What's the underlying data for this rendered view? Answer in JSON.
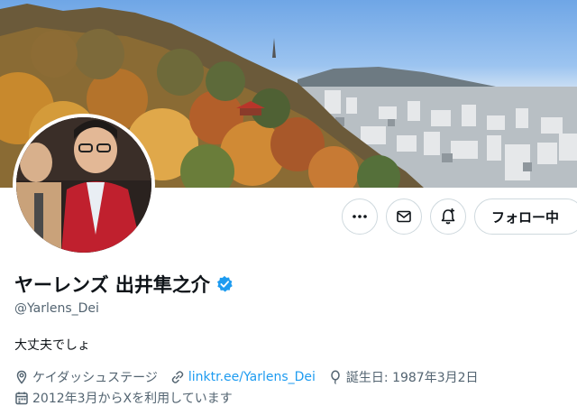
{
  "profile": {
    "display_name": "ヤーレンズ 出井隼之介",
    "verified": true,
    "handle": "@Yarlens_Dei",
    "bio": "大丈夫でしょ",
    "location": "ケイダッシュステージ",
    "website": "linktr.ee/Yarlens_Dei",
    "birthday": "誕生日: 1987年3月2日",
    "joined": "2012年3月からXを利用しています"
  },
  "actions": {
    "follow_label": "フォロー中"
  },
  "icons": {
    "more": "more-icon",
    "message": "mail-icon",
    "notify": "bell-plus-icon",
    "location": "location-pin-icon",
    "link": "link-icon",
    "birthday": "balloon-icon",
    "joined": "calendar-icon",
    "verified": "verified-badge-icon"
  },
  "colors": {
    "accent": "#1d9bf0",
    "text": "#0f1419",
    "secondary_text": "#536471",
    "border": "#cfd9de"
  }
}
